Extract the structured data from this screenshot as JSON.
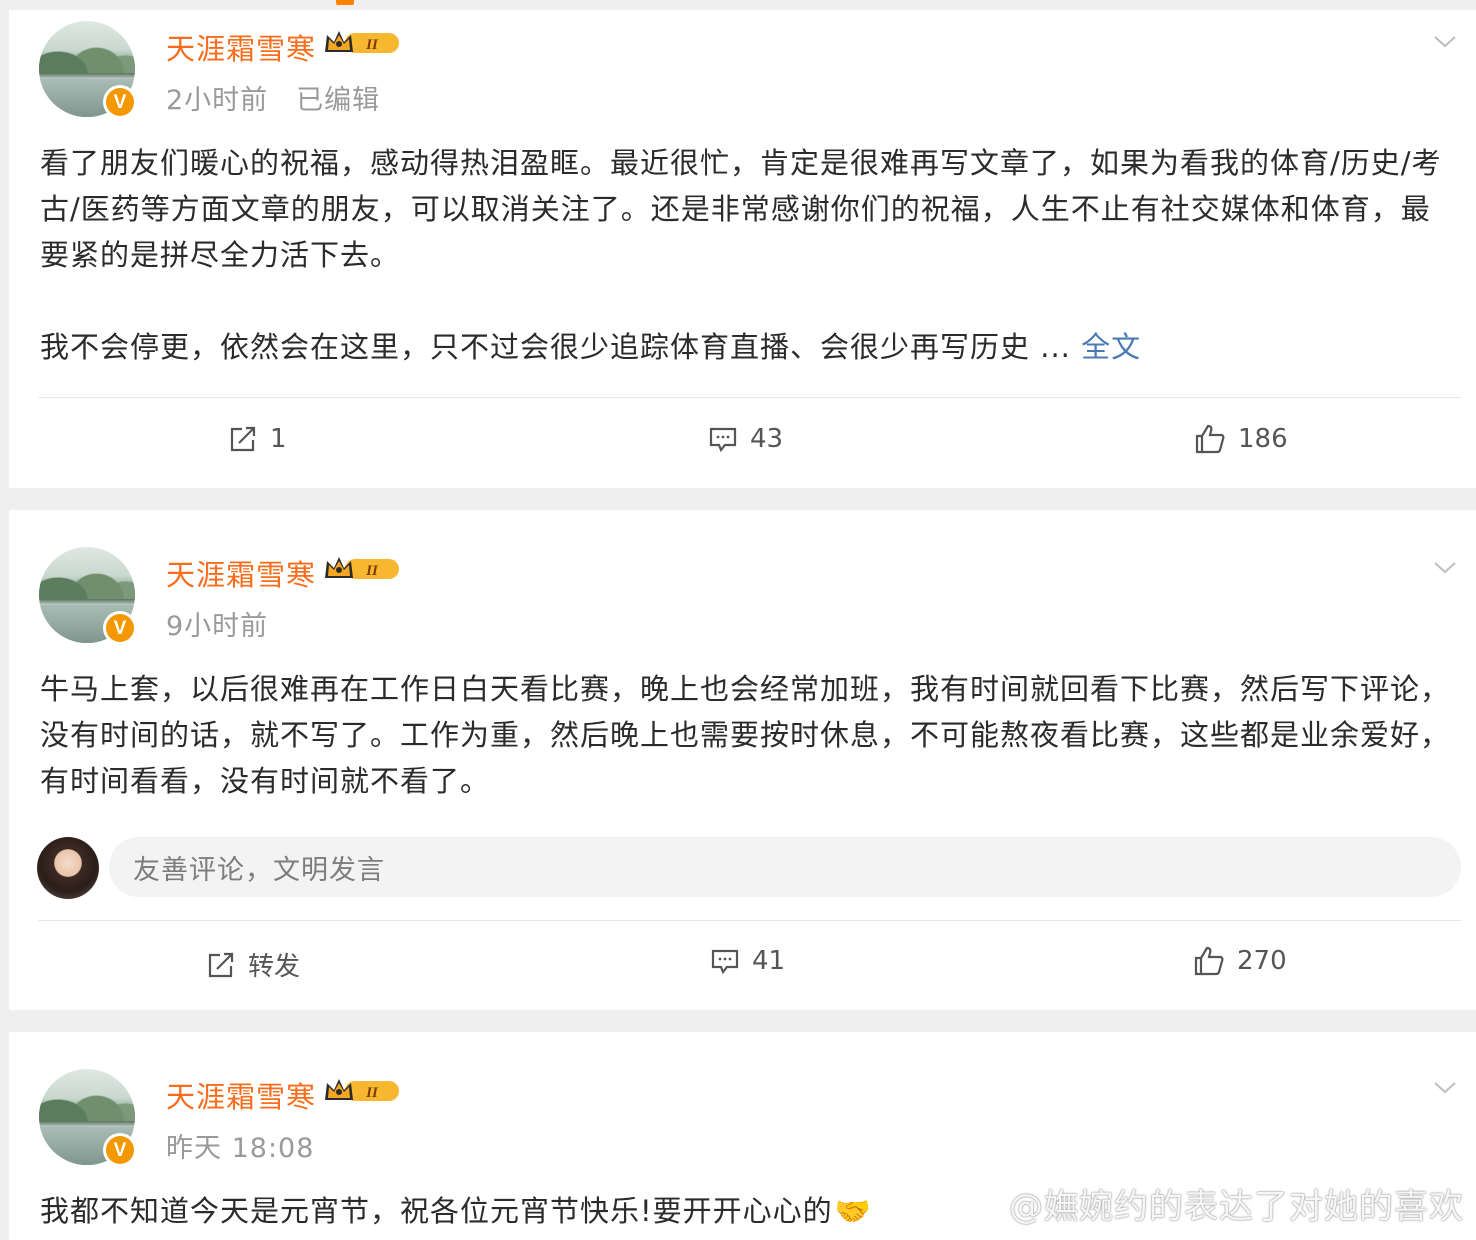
{
  "posts": [
    {
      "author": "天涯霜雪寒",
      "time": "2小时前",
      "edited": "已编辑",
      "paragraphs": [
        "看了朋友们暖心的祝福，感动得热泪盈眶。最近很忙，肯定是很难再写文章了，如果为看我的体育/历史/考古/医药等方面文章的朋友，可以取消关注了。还是非常感谢你们的祝福，人生不止有社交媒体和体育，最要紧的是拼尽全力活下去。",
        "我不会停更，依然会在这里，只不过会很少追踪体育直播、会很少再写历史 ..."
      ],
      "more_label": "全文",
      "repost": "1",
      "comments": "43",
      "likes": "186"
    },
    {
      "author": "天涯霜雪寒",
      "time": "9小时前",
      "paragraphs": [
        "牛马上套，以后很难再在工作日白天看比赛，晚上也会经常加班，我有时间就回看下比赛，然后写下评论，没有时间的话，就不写了。工作为重，然后晚上也需要按时休息，不可能熬夜看比赛，这些都是业余爱好，有时间看看，没有时间就不看了。"
      ],
      "comment_placeholder": "友善评论，文明发言",
      "repost": "转发",
      "comments": "41",
      "likes": "270"
    },
    {
      "author": "天涯霜雪寒",
      "time": "昨天 18:08",
      "paragraphs": [
        "我都不知道今天是元宵节，祝各位元宵节快乐!要开开心心的"
      ]
    }
  ],
  "badge": {
    "level": "II"
  },
  "verified_mark": "V",
  "watermark": "@嫵婉约的表达了对她的喜欢",
  "colors": {
    "accent": "#ff8200",
    "username": "#f86d1c",
    "link": "#4b79b4",
    "badge": "#f39800"
  },
  "icons": [
    "repost-icon",
    "comment-icon",
    "like-icon",
    "chevron-down-icon",
    "crown-badge-icon",
    "verified-v-icon"
  ]
}
